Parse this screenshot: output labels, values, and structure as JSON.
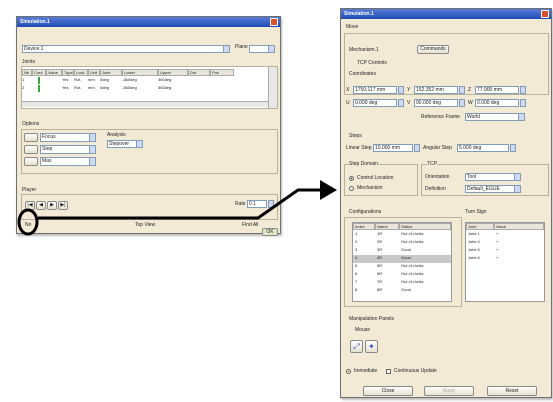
{
  "left_window": {
    "title": "Simulation.1",
    "device": "Device.1",
    "device_field_label": "Plane",
    "section_label": "Joints",
    "columns": [
      "Nb",
      "Cmd",
      "Value",
      "Type",
      "Lock",
      "Unit",
      "Joint",
      "Lower",
      "Upper",
      "Dof",
      "Pos"
    ],
    "rows": [
      [
        "1",
        "",
        "",
        "Yes",
        "Rot.",
        "mm",
        "0deg",
        "-360deg",
        "360deg",
        "",
        ""
      ],
      [
        "2",
        "",
        "",
        "Yes",
        "Rot.",
        "mm",
        "0deg",
        "-360deg",
        "360deg",
        "",
        ""
      ]
    ],
    "options_label": "Options",
    "option_items": [
      "Focus",
      "Step",
      "Max"
    ],
    "analysis_label": "Analysis",
    "analysis_value": "Stepover",
    "player_label": "Player",
    "player_value": "0.1",
    "bottom_left": "No",
    "bottom_center": "Top View",
    "bottom_right": "Find All",
    "ok_label": "OK"
  },
  "right_window": {
    "title": "Simulation.1",
    "mode_label": "Move",
    "mechanism_label": "Mechanism.1",
    "commands_tab": "Commands",
    "tcp_label": "TCP Controls",
    "coordinates_label": "Coordinates",
    "x_label": "X",
    "y_label": "Y",
    "z_label": "Z",
    "u_label": "U",
    "v_label": "V",
    "w_label": "W",
    "x_value": "1750.117 mm",
    "y_value": "152.352 mm",
    "z_value": "77.900 mm",
    "u_value": "0.000 deg",
    "v_value": "90.000 deg",
    "w_value": "0.000 deg",
    "reference_label": "Reference Frame",
    "reference_value": "World",
    "steps_label": "Steps",
    "linear_step_label": "Linear Step",
    "linear_step_value": "10.000 mm",
    "angular_step_label": "Angular Step",
    "angular_step_value": "5.000 deg",
    "step_domain_label": "Step Domain",
    "control_label": "Control Location",
    "mech_label": "Mechanism",
    "tcp_group_label": "TCP",
    "orientation_label": "Orientation",
    "orientation_value": "Tool",
    "definition_label": "Definition",
    "definition_value": "Default_EGUE",
    "configurations_label": "Configurations",
    "config_columns": [
      "Index",
      "Name",
      "Status"
    ],
    "configs": [
      [
        "1",
        "1R",
        "Out of Limits"
      ],
      [
        "2",
        "2R",
        "Out of Limits"
      ],
      [
        "3",
        "3R",
        "Good"
      ],
      [
        "4",
        "4R",
        "Good"
      ],
      [
        "5",
        "5R",
        "Out of Limits"
      ],
      [
        "6",
        "6R",
        "Out of Limits"
      ],
      [
        "7",
        "7R",
        "Out of Limits"
      ],
      [
        "8",
        "8R",
        "Good"
      ]
    ],
    "turn_sign_label": "Turn Sign",
    "turn_columns": [
      "Joint",
      "Value"
    ],
    "turns": [
      [
        "Joint 1",
        "+"
      ],
      [
        "Joint 4",
        "+"
      ],
      [
        "Joint 5",
        "+"
      ],
      [
        "Joint 6",
        "+"
      ]
    ],
    "manip_label": "Manipulation Panels",
    "mouse_label": "Mouse",
    "immediate_label": "Immediate",
    "continuous_label": "Continuous Update",
    "close_label": "Close",
    "apply_label": "Apply",
    "reset_label": "Reset"
  },
  "colors": {
    "title": "#2a58c4",
    "accent": "#e0731c",
    "window": "#f3ead6"
  }
}
